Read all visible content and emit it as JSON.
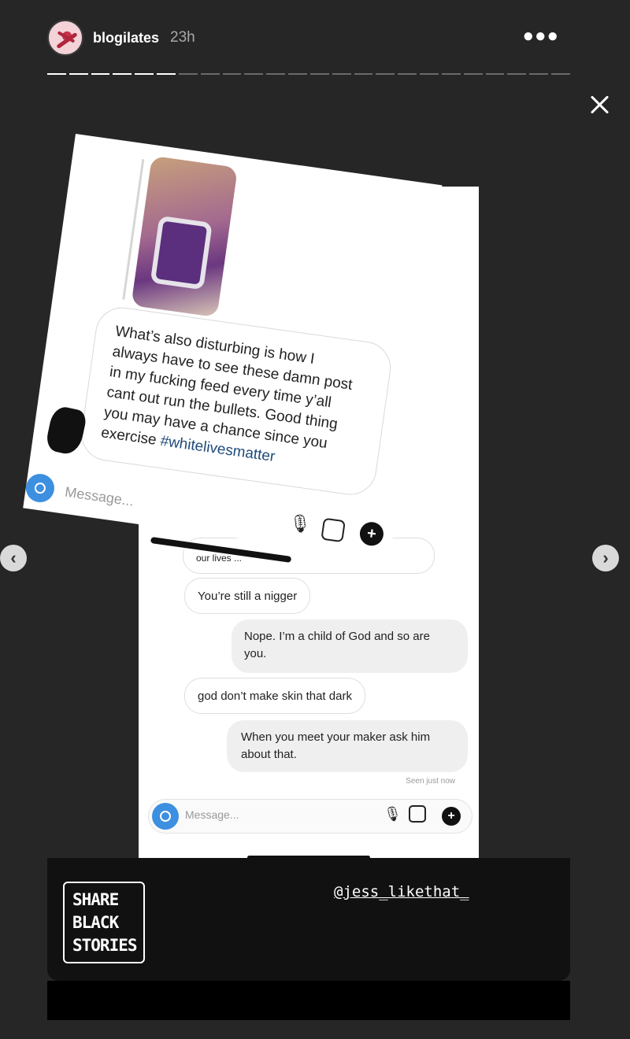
{
  "header": {
    "username": "blogilates",
    "time": "23h",
    "more_icon": "ellipsis-icon"
  },
  "progress": {
    "segments": 24,
    "completed": 6
  },
  "front_screenshot": {
    "message_lines": [
      "What’s also disturbing is how I",
      "always have to see these damn post",
      "in my fucking feed every time y’all",
      "cant out run the bullets. Good thing",
      "you may have a chance since you"
    ],
    "message_last": "exercise ",
    "hashtag": "#whitelivesmatter",
    "input_placeholder": "Message..."
  },
  "back_screenshot": {
    "partial": "our lives ...",
    "messages": [
      {
        "from": "them",
        "text": "You’re still a nigger"
      },
      {
        "from": "me",
        "text": "Nope. I’m a child of God and so are you."
      },
      {
        "from": "them",
        "text": "god don’t make skin that dark"
      },
      {
        "from": "me",
        "text": "When you meet your maker ask him about that."
      }
    ],
    "seen": "Seen just now",
    "input_placeholder": "Message..."
  },
  "footer": {
    "logo_lines": [
      "SHARE",
      "BLACK",
      "STORIES"
    ],
    "mention": "@jess_likethat_"
  }
}
